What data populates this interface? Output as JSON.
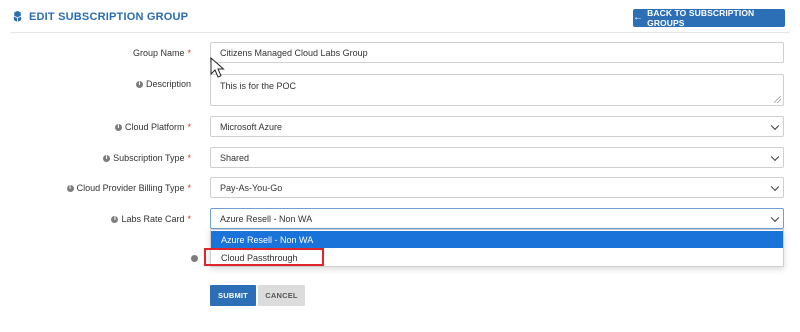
{
  "header": {
    "title": "EDIT SUBSCRIPTION GROUP",
    "back_button": "BACK TO SUBSCRIPTION GROUPS"
  },
  "form": {
    "group_name": {
      "label": "Group Name",
      "value": "Citizens Managed Cloud Labs Group",
      "required": "*"
    },
    "description": {
      "label": "Description",
      "value": "This is for the POC"
    },
    "cloud_platform": {
      "label": "Cloud Platform",
      "value": "Microsoft Azure",
      "required": "*"
    },
    "subscription_type": {
      "label": "Subscription Type",
      "value": "Shared",
      "required": "*"
    },
    "billing_type": {
      "label": "Cloud Provider Billing Type",
      "value": "Pay-As-You-Go",
      "required": "*"
    },
    "labs_rate_card": {
      "label": "Labs Rate Card",
      "value": "Azure Resell - Non WA",
      "required": "*",
      "options": [
        "Azure Resell - Non WA",
        "Cloud Passthrough"
      ]
    }
  },
  "buttons": {
    "submit": "SUBMIT",
    "cancel": "CANCEL"
  },
  "icons": {
    "info": "i",
    "header": "cubes-icon"
  },
  "colors": {
    "primary": "#2d6fb6",
    "required": "#d0322f",
    "dropdown_selected": "#1a73d9",
    "highlight": "#e0252a"
  }
}
